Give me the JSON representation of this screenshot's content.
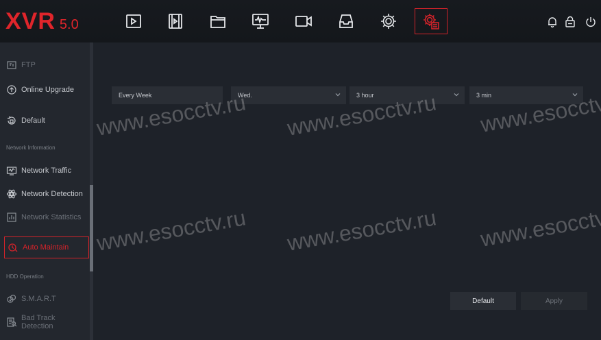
{
  "logo": {
    "brand": "XVR",
    "version": "5.0"
  },
  "nav": [
    {
      "icon": "playback-icon"
    },
    {
      "icon": "video-clip-icon"
    },
    {
      "icon": "folder-icon"
    },
    {
      "icon": "monitor-icon"
    },
    {
      "icon": "camera-icon"
    },
    {
      "icon": "storage-icon"
    },
    {
      "icon": "gear-icon"
    },
    {
      "icon": "system-settings-icon",
      "active": true
    }
  ],
  "top_right": [
    "bell-icon",
    "lock-icon",
    "power-icon"
  ],
  "sidebar": {
    "items": [
      {
        "label": "FTP",
        "icon": "ftp-icon"
      },
      {
        "label": "Online Upgrade",
        "icon": "upgrade-icon"
      },
      {
        "label": "Default",
        "icon": "default-icon"
      },
      {
        "label": "Network Traffic",
        "icon": "network-traffic-icon"
      },
      {
        "label": "Network Detection",
        "icon": "network-detection-icon"
      },
      {
        "label": "Network Statistics",
        "icon": "network-statistics-icon"
      },
      {
        "label": "Auto Maintain",
        "icon": "auto-maintain-icon",
        "active": true
      },
      {
        "label": "S.M.A.R.T",
        "icon": "smart-icon"
      },
      {
        "label": "Bad Track Detection",
        "icon": "bad-track-icon"
      }
    ],
    "sections": {
      "network_information": "Network Information",
      "hdd_operation": "HDD Operation"
    }
  },
  "maintain": {
    "frequency": "Every Week",
    "day": "Wed.",
    "hour": "3 hour",
    "minute": "3 min"
  },
  "buttons": {
    "default": "Default",
    "apply": "Apply"
  },
  "watermark": "www.esocctv.ru",
  "colors": {
    "accent": "#d4232a",
    "background": "#1e2229",
    "sidebar": "#23272e"
  }
}
